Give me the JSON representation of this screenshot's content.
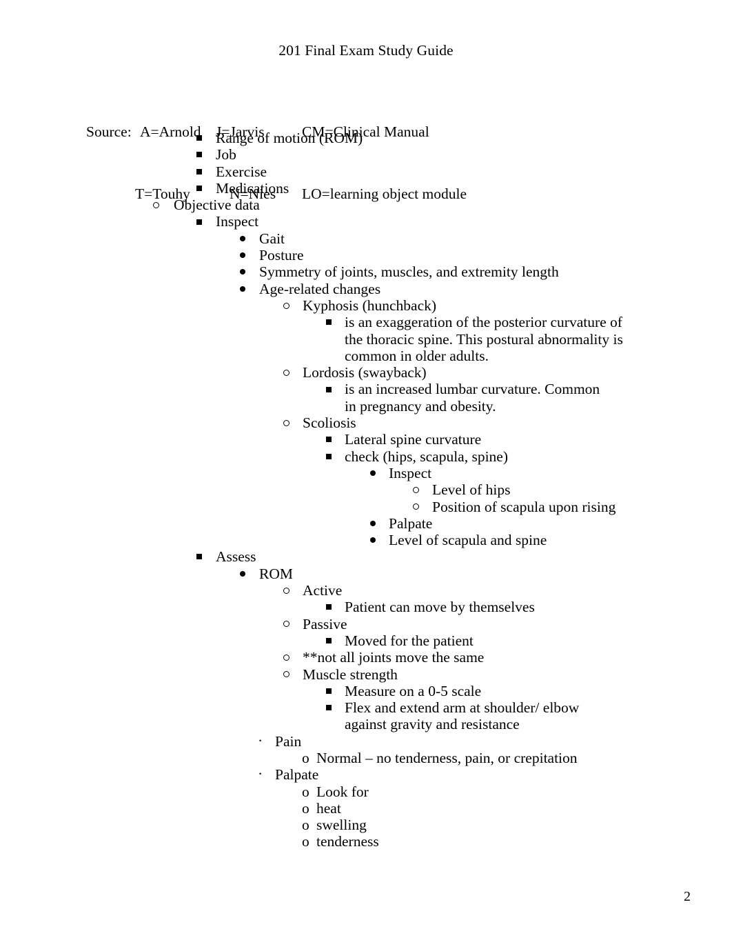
{
  "document": {
    "title": "201 Final Exam Study Guide",
    "page_number": "2"
  },
  "source_legend": {
    "label": "Source:",
    "row1": {
      "col1": "A=Arnold",
      "col2": "J=Jarvis",
      "col3": "CM=Clinical Manual"
    },
    "row2": {
      "col1": "T=Touhy",
      "col2": "N=Nies",
      "col3": "LO=learning object module"
    }
  },
  "outline": [
    {
      "id": "range-of-motion",
      "level": 3,
      "bullet": "square",
      "text": "Range of motion (ROM)"
    },
    {
      "id": "job",
      "level": 3,
      "bullet": "square",
      "text": "Job"
    },
    {
      "id": "exercise",
      "level": 3,
      "bullet": "square",
      "text": "Exercise"
    },
    {
      "id": "medications",
      "level": 3,
      "bullet": "square",
      "text": "Medications"
    },
    {
      "id": "objective-data",
      "level": 2,
      "bullet": "ring",
      "text": "Objective data"
    },
    {
      "id": "inspect",
      "level": 3,
      "bullet": "square",
      "text": "Inspect"
    },
    {
      "id": "gait",
      "level": 4,
      "bullet": "disc",
      "text": "Gait"
    },
    {
      "id": "posture",
      "level": 4,
      "bullet": "disc",
      "text": "Posture"
    },
    {
      "id": "symmetry",
      "level": 4,
      "bullet": "disc",
      "text": "Symmetry of joints, muscles, and extremity length"
    },
    {
      "id": "age-related-changes",
      "level": 4,
      "bullet": "disc",
      "text": "Age-related changes"
    },
    {
      "id": "kyphosis",
      "level": 5,
      "bullet": "ring",
      "text": "Kyphosis (hunchback)"
    },
    {
      "id": "kyphosis-definition",
      "level": 6,
      "bullet": "square",
      "text": " is an exaggeration of the posterior curvature of the thoracic spine. This postural abnormality is common in older adults."
    },
    {
      "id": "lordosis",
      "level": 5,
      "bullet": "ring",
      "text": "Lordosis (swayback)"
    },
    {
      "id": "lordosis-definition",
      "level": 6,
      "bullet": "square",
      "text": "is an increased lumbar curvature. Common in pregnancy and obesity."
    },
    {
      "id": "scoliosis",
      "level": 5,
      "bullet": "ring",
      "text": "Scoliosis"
    },
    {
      "id": "lateral-spine-curvature",
      "level": 6,
      "bullet": "square",
      "text": " Lateral spine curvature"
    },
    {
      "id": "check-hips-scapula-spine",
      "level": 6,
      "bullet": "square",
      "text": "check (hips, scapula, spine)"
    },
    {
      "id": "scoliosis-inspect",
      "level": 7,
      "bullet": "disc",
      "text": "Inspect"
    },
    {
      "id": "level-of-hips",
      "level": 8,
      "bullet": "ring",
      "text": "Level of hips"
    },
    {
      "id": "position-of-scapula",
      "level": 8,
      "bullet": "ring",
      "text": "Position of scapula upon rising"
    },
    {
      "id": "scoliosis-palpate",
      "level": 7,
      "bullet": "disc",
      "text": "Palpate"
    },
    {
      "id": "level-of-scapula-and-spine",
      "level": 7,
      "bullet": "disc",
      "text": "Level of scapula and spine"
    },
    {
      "id": "assess",
      "level": 3,
      "bullet": "square",
      "text": "Assess"
    },
    {
      "id": "rom",
      "level": 4,
      "bullet": "disc",
      "text": "ROM"
    },
    {
      "id": "active",
      "level": 5,
      "bullet": "ring",
      "text": "Active"
    },
    {
      "id": "active-detail",
      "level": 6,
      "bullet": "square",
      "text": "Patient can move by themselves"
    },
    {
      "id": "passive",
      "level": 5,
      "bullet": "ring",
      "text": "Passive"
    },
    {
      "id": "passive-detail",
      "level": 6,
      "bullet": "square",
      "text": "Moved for the patient"
    },
    {
      "id": "not-all-joints",
      "level": 5,
      "bullet": "ring",
      "text": "**not all joints move the same"
    },
    {
      "id": "muscle-strength",
      "level": 5,
      "bullet": "ring",
      "text": "Muscle strength"
    },
    {
      "id": "measure-scale",
      "level": 6,
      "bullet": "square",
      "text": "Measure on a 0-5 scale"
    },
    {
      "id": "flex-extend-arm",
      "level": 6,
      "bullet": "square",
      "text": "Flex and extend arm at shoulder/ elbow against gravity and resistance"
    },
    {
      "id": "pain",
      "level": 4,
      "bullet": "middot",
      "text": "Pain"
    },
    {
      "id": "pain-normal",
      "level": 5,
      "bullet": "o-text",
      "text": "Normal – no tenderness, pain, or crepitation"
    },
    {
      "id": "palpate",
      "level": 4,
      "bullet": "middot",
      "text": "Palpate"
    },
    {
      "id": "palpate-look-for",
      "level": 5,
      "bullet": "o-text",
      "text": "Look for"
    },
    {
      "id": "palpate-heat",
      "level": 5,
      "bullet": "o-text",
      "text": "heat"
    },
    {
      "id": "palpate-swelling",
      "level": 5,
      "bullet": "o-text",
      "text": "swelling"
    },
    {
      "id": "palpate-tenderness",
      "level": 5,
      "bullet": "o-text",
      "text": "tenderness"
    }
  ]
}
